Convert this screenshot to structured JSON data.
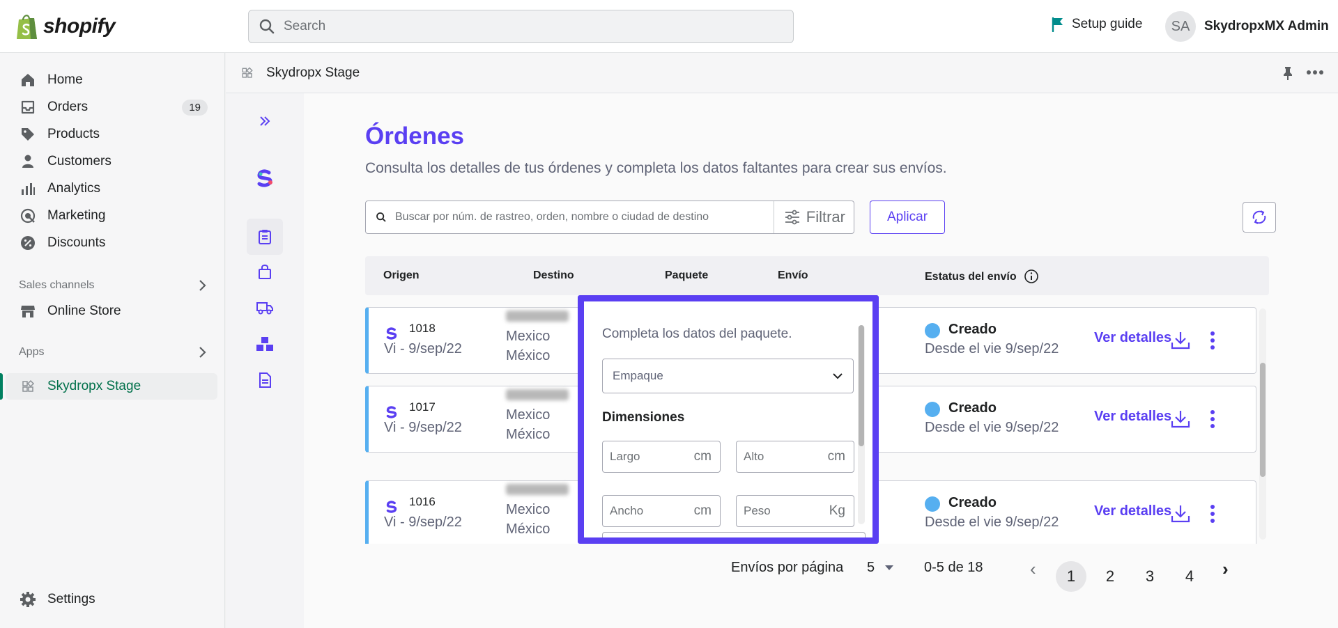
{
  "topbar": {
    "brand": "shopify",
    "search_placeholder": "Search",
    "setup_guide": "Setup guide",
    "user_initials": "SA",
    "user_name": "SkydropxMX Admin"
  },
  "nav": {
    "items": [
      {
        "label": "Home",
        "icon": "home-icon"
      },
      {
        "label": "Orders",
        "icon": "orders-icon",
        "badge": "19"
      },
      {
        "label": "Products",
        "icon": "tag-icon"
      },
      {
        "label": "Customers",
        "icon": "person-icon"
      },
      {
        "label": "Analytics",
        "icon": "bar-chart-icon"
      },
      {
        "label": "Marketing",
        "icon": "target-icon"
      },
      {
        "label": "Discounts",
        "icon": "discount-icon"
      }
    ],
    "sales_channels_label": "Sales channels",
    "online_store": "Online Store",
    "apps_label": "Apps",
    "active_app": "Skydropx Stage",
    "settings": "Settings"
  },
  "app_header": {
    "title": "Skydropx Stage"
  },
  "page": {
    "title": "Órdenes",
    "subtitle": "Consulta los detalles de tus órdenes y completa los datos faltantes para crear sus envíos.",
    "search_placeholder": "Buscar por núm. de rastreo, orden, nombre o ciudad de destino",
    "filter_label": "Filtrar",
    "apply_label": "Aplicar"
  },
  "table": {
    "headers": {
      "origen": "Origen",
      "destino": "Destino",
      "paquete": "Paquete",
      "envio": "Envío",
      "estatus": "Estatus del envío"
    },
    "rows": [
      {
        "order": "1018",
        "date": "Vi - 9/sep/22",
        "dest_line1": "Mexico",
        "dest_line2": "México",
        "status": "Creado",
        "since": "Desde el vie 9/sep/22",
        "action": "Ver detalles"
      },
      {
        "order": "1017",
        "date": "Vi - 9/sep/22",
        "dest_line1": "Mexico",
        "dest_line2": "México",
        "status": "Creado",
        "since": "Desde el vie 9/sep/22",
        "action": "Ver detalles"
      },
      {
        "order": "1016",
        "date": "Vi - 9/sep/22",
        "dest_line1": "Mexico",
        "dest_line2": "México",
        "status": "Creado",
        "since": "Desde el vie 9/sep/22",
        "action": "Ver detalles"
      }
    ]
  },
  "pagination": {
    "per_page_label": "Envíos por página",
    "per_page_value": "5",
    "range": "0-5 de 18",
    "pages": [
      "1",
      "2",
      "3",
      "4"
    ],
    "current": "1",
    "prev": "‹",
    "next": "›"
  },
  "popover": {
    "title": "Completa los datos del paquete.",
    "packaging_placeholder": "Empaque",
    "dimensions_label": "Dimensiones",
    "fields": {
      "largo": {
        "label": "Largo",
        "unit": "cm"
      },
      "alto": {
        "label": "Alto",
        "unit": "cm"
      },
      "ancho": {
        "label": "Ancho",
        "unit": "cm"
      },
      "peso": {
        "label": "Peso",
        "unit": "Kg"
      }
    }
  },
  "colors": {
    "accent": "#5a3ff2",
    "status_blue": "#56aff0",
    "shopify_green": "#008060"
  }
}
